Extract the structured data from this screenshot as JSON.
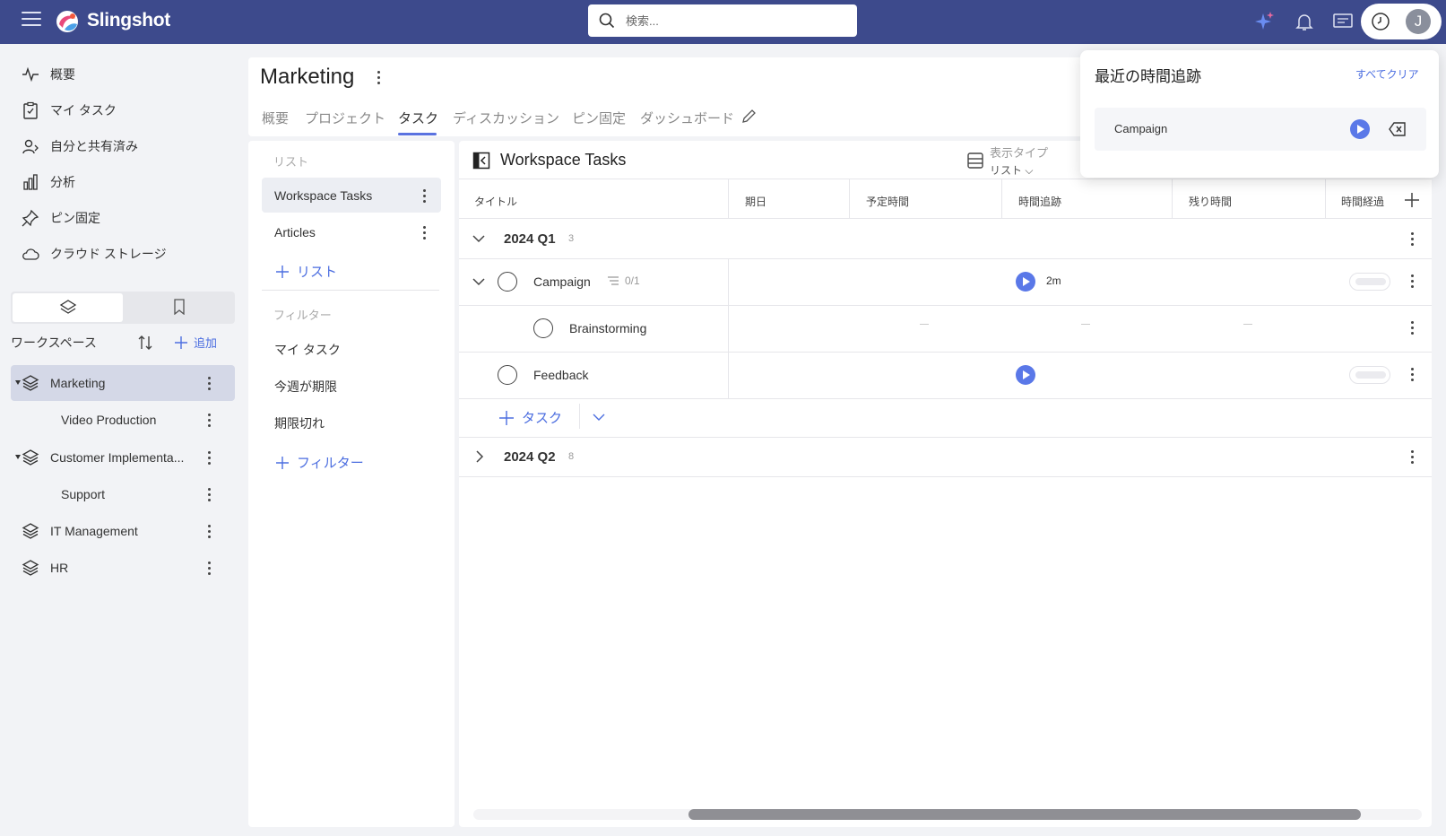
{
  "app": {
    "name": "Slingshot"
  },
  "search": {
    "placeholder": "検索..."
  },
  "user": {
    "avatar_initial": "J"
  },
  "nav": {
    "items": [
      {
        "label": "概要",
        "icon": "activity-icon"
      },
      {
        "label": "マイ タスク",
        "icon": "clipboard-check-icon"
      },
      {
        "label": "自分と共有済み",
        "icon": "shared-user-icon"
      },
      {
        "label": "分析",
        "icon": "bar-chart-icon"
      },
      {
        "label": "ピン固定",
        "icon": "pin-icon"
      },
      {
        "label": "クラウド ストレージ",
        "icon": "cloud-icon"
      }
    ]
  },
  "workspaces": {
    "heading": "ワークスペース",
    "add_label": "追加",
    "items": [
      {
        "label": "Marketing"
      },
      {
        "label": "Video Production"
      },
      {
        "label": "Customer Implementa..."
      },
      {
        "label": "Support"
      },
      {
        "label": "IT Management"
      },
      {
        "label": "HR"
      }
    ]
  },
  "header": {
    "title": "Marketing",
    "tabs": [
      {
        "label": "概要"
      },
      {
        "label": "プロジェクト"
      },
      {
        "label": "タスク"
      },
      {
        "label": "ディスカッション"
      },
      {
        "label": "ピン固定"
      },
      {
        "label": "ダッシュボード"
      }
    ],
    "active_tab": "タスク"
  },
  "lists": {
    "section_label": "リスト",
    "items": [
      {
        "label": "Workspace Tasks"
      },
      {
        "label": "Articles"
      }
    ],
    "add_label": "リスト",
    "filter_section_label": "フィルター",
    "filters": [
      {
        "label": "マイ タスク"
      },
      {
        "label": "今週が期限"
      },
      {
        "label": "期限切れ"
      }
    ],
    "add_filter_label": "フィルター"
  },
  "main": {
    "title": "Workspace Tasks",
    "view_type_label": "表示タイプ",
    "view_type_value": "リスト",
    "columns": [
      "タイトル",
      "期日",
      "予定時間",
      "時間追跡",
      "残り時間",
      "時間経過"
    ],
    "groups": [
      {
        "name": "2024 Q1",
        "count": "3"
      },
      {
        "name": "2024 Q2",
        "count": "8"
      }
    ],
    "tasks": [
      {
        "name": "Campaign",
        "subtasks": "0/1",
        "tracked": "2m"
      },
      {
        "name": "Brainstorming"
      },
      {
        "name": "Feedback"
      }
    ],
    "add_task_label": "タスク"
  },
  "popover": {
    "title": "最近の時間追跡",
    "clear_label": "すべてクリア",
    "items": [
      {
        "label": "Campaign"
      }
    ]
  },
  "colors": {
    "topbar": "#3d4a8c",
    "accent": "#4c6ee0",
    "play": "#5a78e8",
    "active_workspace": "#d4d8e7"
  }
}
